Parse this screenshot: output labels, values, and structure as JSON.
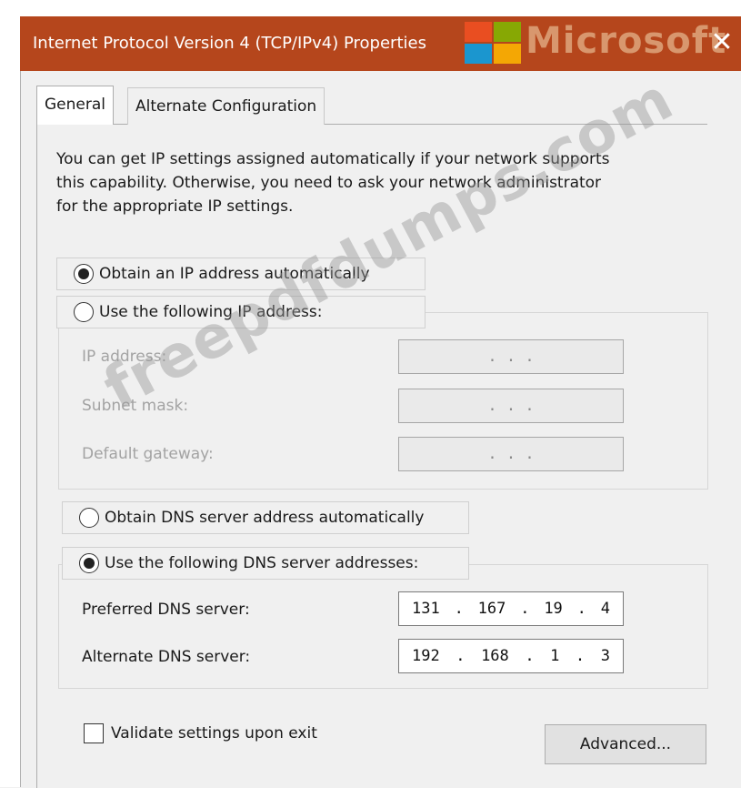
{
  "window": {
    "title": "Internet Protocol Version 4 (TCP/IPv4) Properties",
    "close_glyph": "✕",
    "watermark_logo": "Microsoft"
  },
  "tabs": [
    {
      "label": "General",
      "selected": true
    },
    {
      "label": "Alternate Configuration",
      "selected": false
    }
  ],
  "description": {
    "line1": "You can get IP settings assigned automatically if your network supports",
    "line2": "this capability. Otherwise, you need to ask your network administrator",
    "line3": "for the appropriate IP settings."
  },
  "ip_section": {
    "auto_label": "Obtain an IP address automatically",
    "auto_selected": true,
    "manual_label": "Use the following IP address:",
    "manual_selected": false,
    "fields": [
      {
        "label": "IP address:",
        "value": ". . ."
      },
      {
        "label": "Subnet mask:",
        "value": ". . ."
      },
      {
        "label": "Default gateway:",
        "value": ". . ."
      }
    ]
  },
  "dns_section": {
    "auto_label": "Obtain DNS server address automatically",
    "auto_selected": false,
    "manual_label": "Use the following DNS server addresses:",
    "manual_selected": true,
    "preferred_label": "Preferred DNS server:",
    "preferred_octets": [
      "131",
      "167",
      "19",
      "4"
    ],
    "alternate_label": "Alternate DNS server:",
    "alternate_octets": [
      "192",
      "168",
      "1",
      "3"
    ]
  },
  "footer": {
    "validate_label": "Validate settings upon exit",
    "validate_checked": false,
    "advanced_label": "Advanced..."
  },
  "overlay": {
    "watermark_text": "freepdfdumps.com"
  },
  "colors": {
    "titlebar": "#b5461c",
    "ms_red": "#f25022",
    "ms_green": "#7fba00",
    "ms_blue": "#00a4ef",
    "ms_yellow": "#ffb900"
  }
}
